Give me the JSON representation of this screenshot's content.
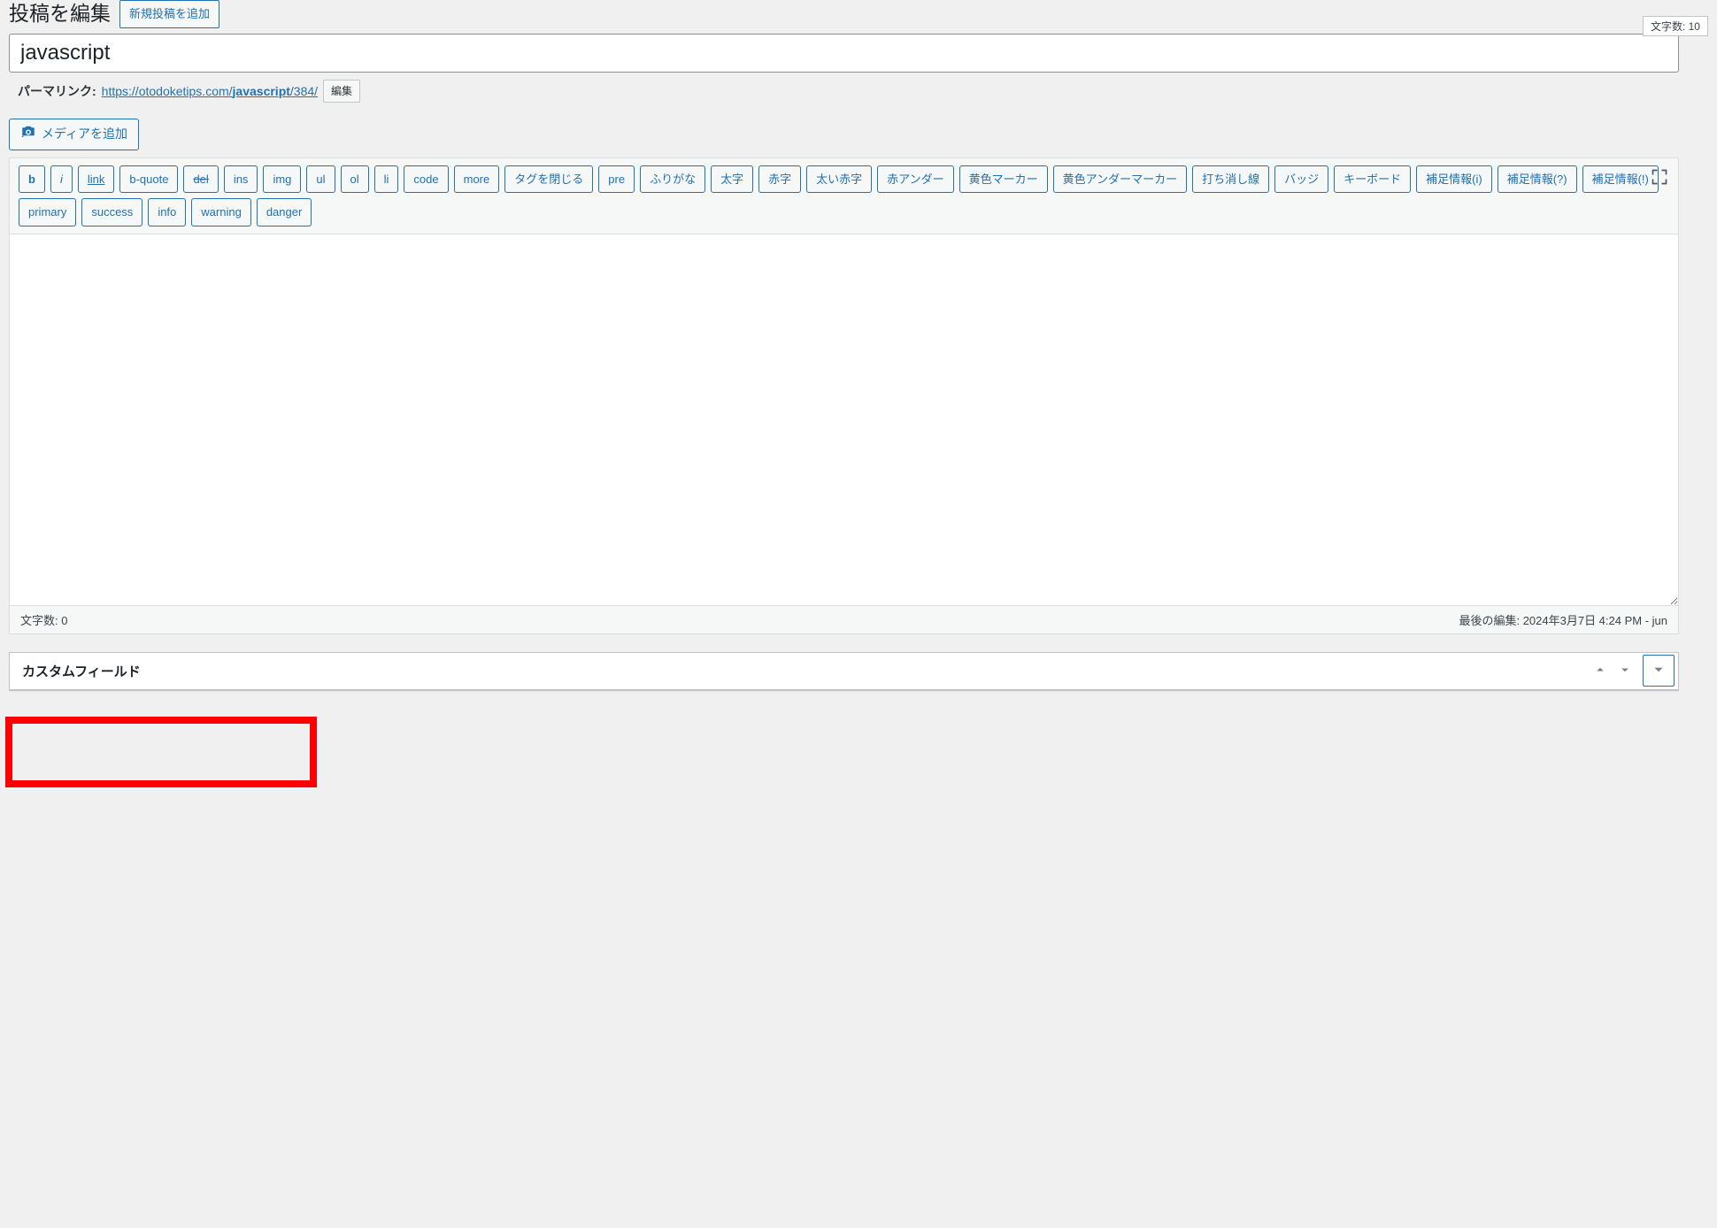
{
  "header": {
    "title": "投稿を編集",
    "add_new_label": "新規投稿を追加"
  },
  "char_count_top": "文字数: 10",
  "title_input_value": "javascript",
  "permalink": {
    "label": "パーマリンク:",
    "base": "https://otodoketips.com/",
    "slug": "javascript",
    "tail": "/384/",
    "edit_label": "編集"
  },
  "media_button_label": "メディアを追加",
  "quicktags_row1": [
    {
      "label": "b",
      "style": "bold"
    },
    {
      "label": "i",
      "style": "italic"
    },
    {
      "label": "link",
      "style": "underline"
    },
    {
      "label": "b-quote"
    },
    {
      "label": "del",
      "style": "strike"
    },
    {
      "label": "ins"
    },
    {
      "label": "img"
    },
    {
      "label": "ul"
    },
    {
      "label": "ol"
    },
    {
      "label": "li"
    },
    {
      "label": "code"
    },
    {
      "label": "more"
    },
    {
      "label": "タグを閉じる"
    },
    {
      "label": "pre"
    },
    {
      "label": "ふりがな"
    },
    {
      "label": "太字"
    },
    {
      "label": "赤字"
    },
    {
      "label": "太い赤字"
    }
  ],
  "quicktags_row2": [
    {
      "label": "赤アンダー"
    },
    {
      "label": "黄色マーカー"
    },
    {
      "label": "黄色アンダーマーカー"
    },
    {
      "label": "打ち消し線"
    },
    {
      "label": "バッジ"
    },
    {
      "label": "キーボード"
    },
    {
      "label": "補足情報(i)"
    },
    {
      "label": "補足情報(?)"
    },
    {
      "label": "補足情報(!)"
    },
    {
      "label": "primary"
    }
  ],
  "quicktags_row3": [
    {
      "label": "success"
    },
    {
      "label": "info"
    },
    {
      "label": "warning"
    },
    {
      "label": "danger"
    }
  ],
  "editor_content": "",
  "status_bar": {
    "word_count": "文字数: 0",
    "last_edit": "最後の編集: 2024年3月7日 4:24 PM - jun"
  },
  "custom_fields_box": {
    "title": "カスタムフィールド"
  }
}
